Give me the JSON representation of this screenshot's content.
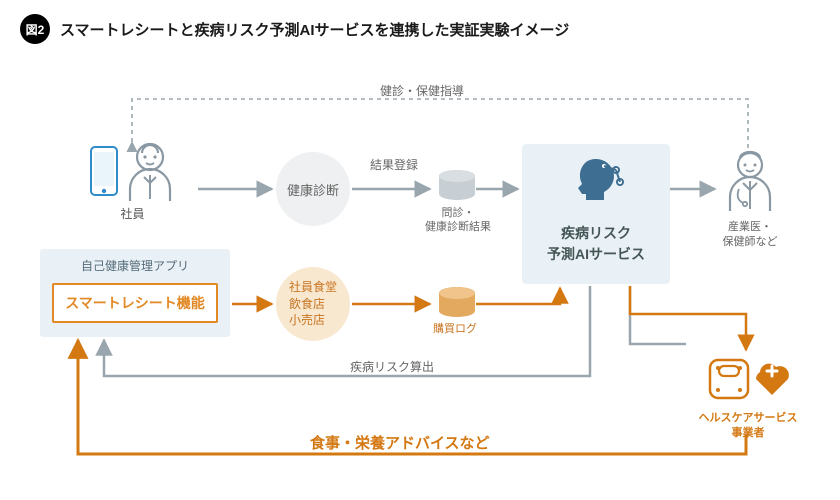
{
  "figureBadge": "図2",
  "figureTitle": "スマートレシートと疾病リスク予測AIサービスを連携した実証実験イメージ",
  "employee": {
    "label": "社員"
  },
  "selfHealthApp": {
    "title": "自己健康管理アプリ"
  },
  "smartReceipt": {
    "label": "スマートレシート機能"
  },
  "healthCheck": {
    "label": "健康診断"
  },
  "resultRegister": "結果登録",
  "medicalResults": {
    "label": "問診・\n健康診断結果"
  },
  "stores": {
    "line1": "社員食堂",
    "line2": "飲食店",
    "line3": "小売店"
  },
  "purchaseLog": {
    "label": "購買ログ"
  },
  "aiService": {
    "line1": "疾病リスク",
    "line2": "予測AIサービス"
  },
  "industrialDoc": {
    "line1": "産業医・",
    "line2": "保健師など"
  },
  "hcProvider": {
    "line1": "ヘルスケアサービス",
    "line2": "事業者"
  },
  "edgeTopDotted": "健診・保健指導",
  "edgeRiskCalc": "疾病リスク算出",
  "edgeAdvice": "食事・栄養アドバイスなど"
}
